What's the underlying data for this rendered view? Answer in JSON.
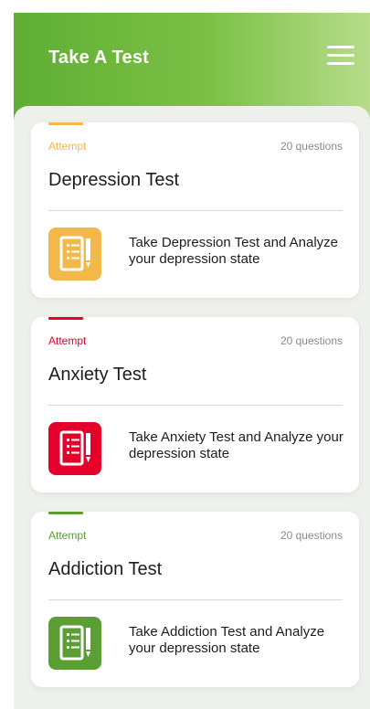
{
  "header": {
    "title": "Take A Test",
    "menu_icon": "hamburger-menu-icon",
    "gradient_start": "#5fae34",
    "gradient_end": "#b7dc8a"
  },
  "tests": [
    {
      "attempt_label": "Attempt",
      "questions_label": "20 questions",
      "title": "Depression Test",
      "description": "Take Depression Test and Analyze your depression state",
      "accent_color": "#f2b84a",
      "icon": "checklist-icon"
    },
    {
      "attempt_label": "Attempt",
      "questions_label": "20 questions",
      "title": "Anxiety Test",
      "description": "Take Anxiety Test and Analyze your depression state",
      "accent_color": "#e4002b",
      "icon": "checklist-icon"
    },
    {
      "attempt_label": "Attempt",
      "questions_label": "20 questions",
      "title": "Addiction Test",
      "description": "Take Addiction Test and Analyze your depression state",
      "accent_color": "#5a9e34",
      "icon": "checklist-icon"
    }
  ]
}
